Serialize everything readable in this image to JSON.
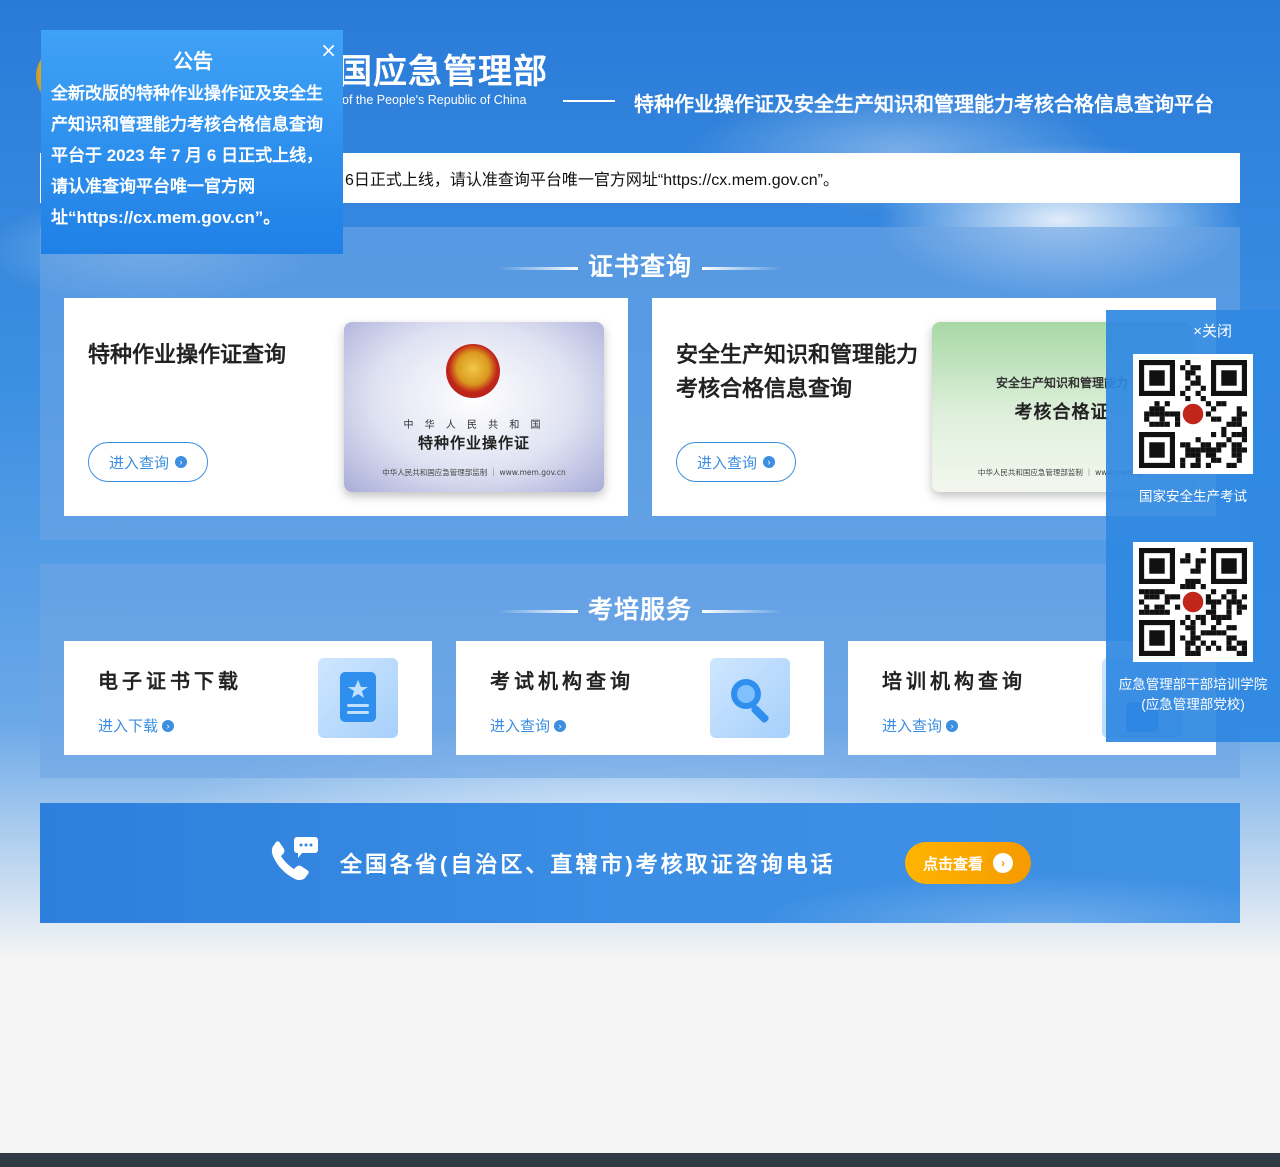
{
  "header": {
    "ministry_cn_visible": "国应急管理部",
    "ministry_en_visible": "of the People's Republic of China",
    "platform_title": "特种作业操作证及安全生产知识和管理能力考核合格信息查询平台"
  },
  "ticker": {
    "text": "6日正式上线，请认准查询平台唯一官方网址“https://cx.mem.gov.cn”。"
  },
  "notice": {
    "title": "公告",
    "body": "全新改版的特种作业操作证及安全生产知识和管理能力考核合格信息查询平台于 2023 年 7 月 6 日正式上线，请认准查询平台唯一官方网址“https://cx.mem.gov.cn”。",
    "close": "×"
  },
  "cert_section": {
    "title": "证书查询",
    "cards": [
      {
        "title": "特种作业操作证查询",
        "button": "进入查询",
        "license_small": "中 华 人 民 共 和 国",
        "license_big": "特种作业操作证",
        "license_foot": "中华人民共和国应急管理部监制 ｜ www.mem.gov.cn"
      },
      {
        "title_line1": "安全生产知识和管理能力",
        "title_line2": "考核合格信息查询",
        "button": "进入查询",
        "license_small": "安全生产知识和管理能力",
        "license_big": "考核合格证",
        "license_foot": "中华人民共和国应急管理部监制 ｜ www.mem.go"
      }
    ]
  },
  "service_section": {
    "title": "考培服务",
    "cards": [
      {
        "title": "电子证书下载",
        "link": "进入下载",
        "icon": "certificate-icon"
      },
      {
        "title": "考试机构查询",
        "link": "进入查询",
        "icon": "magnifier-icon"
      },
      {
        "title": "培训机构查询",
        "link": "进入查询",
        "icon": "book-icon"
      }
    ]
  },
  "banner": {
    "text": "全国各省(自治区、直辖市)考核取证咨询电话",
    "button": "点击查看",
    "icon": "phone-chat-icon"
  },
  "qr_panel": {
    "close": "×关闭",
    "codes": [
      {
        "label": "国家安全生产考试"
      },
      {
        "label_line1": "应急管理部干部培训学院",
        "label_line2": "(应急管理部党校)"
      }
    ]
  },
  "colors": {
    "accent": "#3b8ee0",
    "panel": "#2f88e2",
    "button_orange": "#f59a00"
  }
}
